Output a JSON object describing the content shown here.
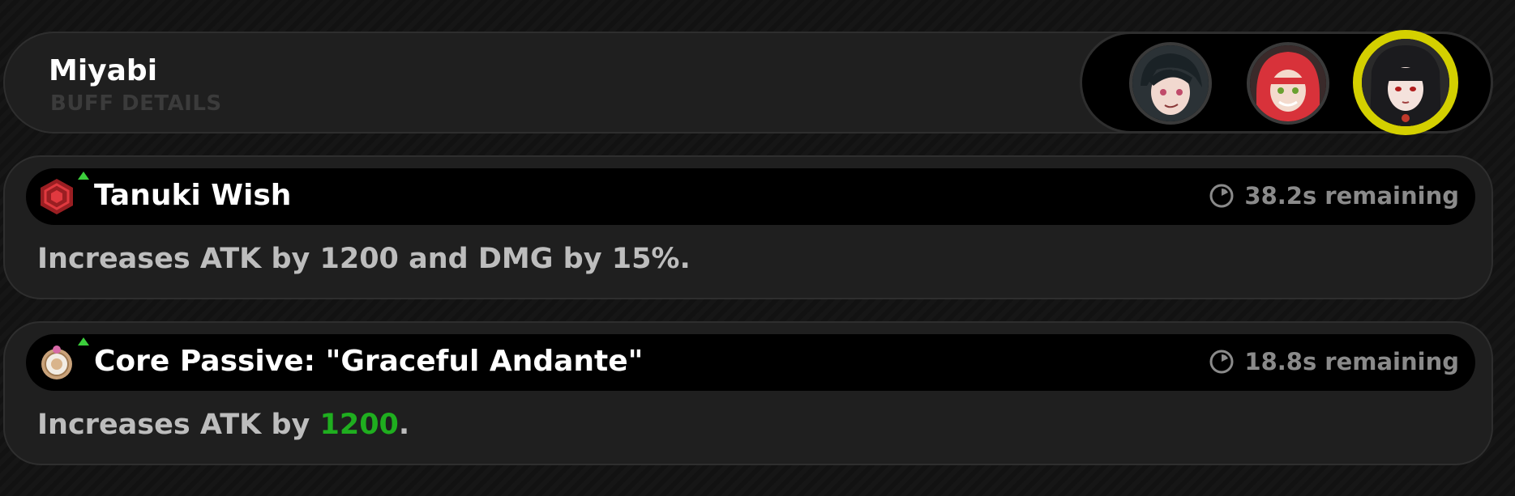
{
  "header": {
    "character_name": "Miyabi",
    "subtitle": "BUFF DETAILS"
  },
  "avatars": [
    {
      "name": "avatar-1",
      "selected": false
    },
    {
      "name": "avatar-2",
      "selected": false
    },
    {
      "name": "avatar-3",
      "selected": true
    }
  ],
  "buffs": [
    {
      "icon": "red-hexagon-buff-icon",
      "name": "Tanuki Wish",
      "remaining": "38.2s remaining",
      "description": "Increases ATK by 1200 and DMG by 15%."
    },
    {
      "icon": "core-passive-badge-icon",
      "name": "Core Passive: \"Graceful Andante\"",
      "remaining": "18.8s remaining",
      "description_prefix": "Increases ATK by ",
      "description_highlight": "1200",
      "description_suffix": "."
    }
  ],
  "colors": {
    "selected_ring": "#d4d000",
    "increase_arrow": "#3ccf3c",
    "highlight_value": "#1fae1f"
  }
}
